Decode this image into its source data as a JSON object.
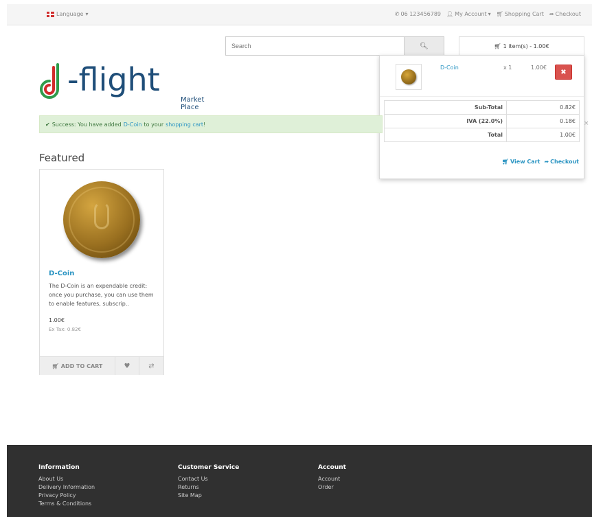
{
  "topbar": {
    "language": "Language",
    "phone": "06 123456789",
    "my_account": "My Account",
    "shopping_cart": "Shopping Cart",
    "checkout": "Checkout"
  },
  "logo": {
    "text": "d-flight",
    "subtitle": "Market Place"
  },
  "search": {
    "placeholder": "Search"
  },
  "cart": {
    "summary": "1 item(s) - 1.00€",
    "item": {
      "name": "D-Coin",
      "qty": "x 1",
      "price": "1.00€"
    },
    "totals": [
      {
        "label": "Sub-Total",
        "value": "0.82€"
      },
      {
        "label": "IVA (22.0%)",
        "value": "0.18€"
      },
      {
        "label": "Total",
        "value": "1.00€"
      }
    ],
    "view_cart": "View Cart",
    "checkout": "Checkout"
  },
  "alert": {
    "prefix": "Success: You have added",
    "product": "D-Coin",
    "middle": "to your",
    "cart_link": "shopping cart",
    "suffix": "!"
  },
  "featured": {
    "title": "Featured",
    "product": {
      "name": "D-Coin",
      "description": "The D-Coin is an expendable credit: once you purchase, you can use them to enable features, subscrip..",
      "price": "1.00€",
      "ex_tax": "Ex Tax: 0.82€",
      "add_to_cart": "ADD TO CART"
    }
  },
  "footer": {
    "columns": [
      {
        "title": "Information",
        "items": [
          "About Us",
          "Delivery Information",
          "Privacy Policy",
          "Terms & Conditions"
        ]
      },
      {
        "title": "Customer Service",
        "items": [
          "Contact Us",
          "Returns",
          "Site Map"
        ]
      },
      {
        "title": "Account",
        "items": [
          "Account",
          "Order"
        ]
      }
    ]
  }
}
